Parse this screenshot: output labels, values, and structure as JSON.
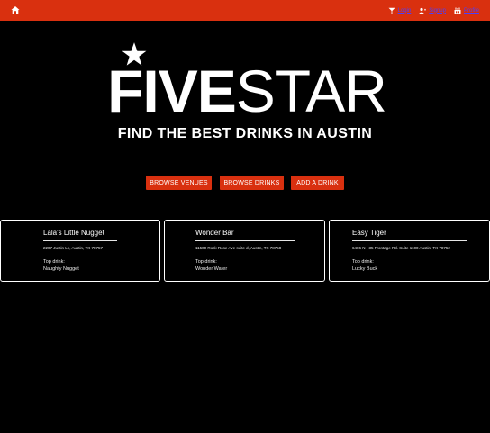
{
  "nav": {
    "login_label": "Login",
    "signup_label": "Signup",
    "profile_label": "Profile",
    "bg_color": "#d9300f",
    "link_color": "#4b3fff",
    "icons": [
      "home-icon",
      "cocktail-icon",
      "add-user-icon",
      "bar-icon"
    ]
  },
  "logo": {
    "bold": "FIVE",
    "light": "STAR"
  },
  "tagline": "FIND THE BEST DRINKS IN AUSTIN",
  "buttons": {
    "browse_venues": "BROWSE VENUES",
    "browse_drinks": "BROWSE DRINKS",
    "add_drink": "ADD A DRINK"
  },
  "venues": [
    {
      "name": "Lala's Little Nugget",
      "address": "2207 Justin Ln, Austin, TX 78757",
      "top_label": "Top drink:",
      "top_drink": "Naughty Nugget"
    },
    {
      "name": "Wonder Bar",
      "address": "11500 Rock Rose Ave suite d, Austin, TX 78758",
      "top_label": "Top drink:",
      "top_drink": "Wonder Water"
    },
    {
      "name": "Easy Tiger",
      "address": "6406 N I-35 Frontage Rd. Suite 1100 Austin, TX 78752",
      "top_label": "Top drink:",
      "top_drink": "Lucky Buck"
    }
  ]
}
